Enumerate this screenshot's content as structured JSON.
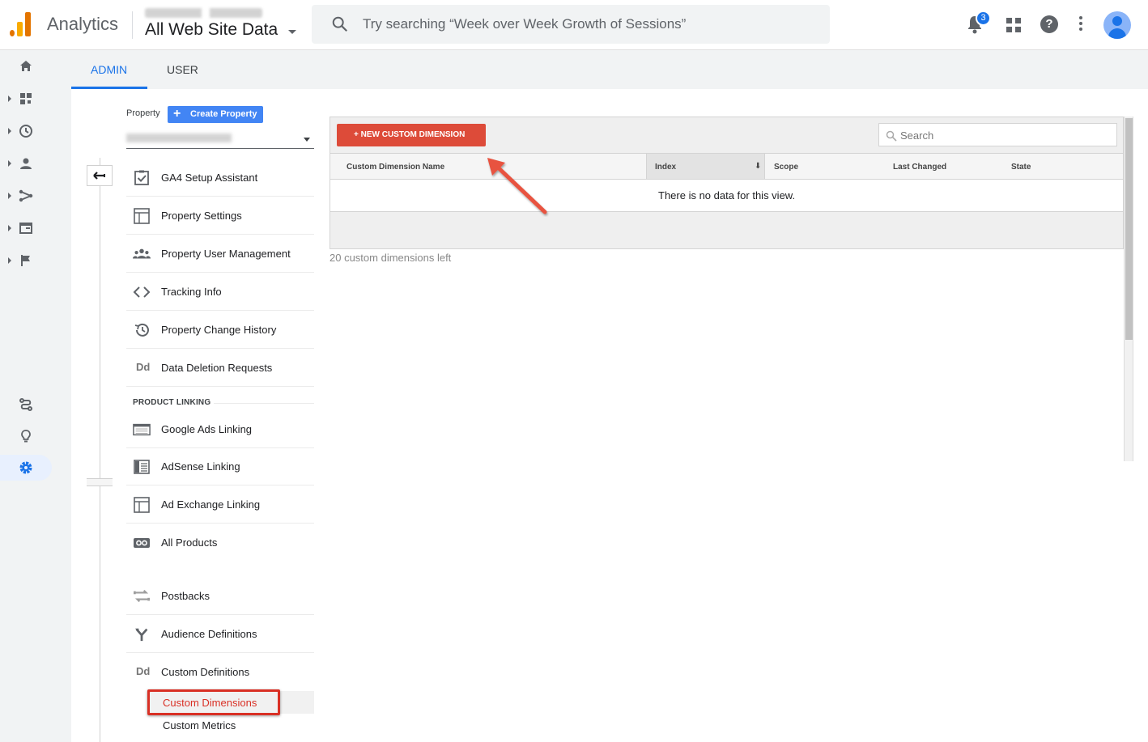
{
  "header": {
    "app_name": "Analytics",
    "view_name": "All Web Site Data",
    "search_placeholder": "Try searching “Week over Week Growth of Sessions”",
    "notification_count": "3",
    "help_label": "?"
  },
  "tabs": {
    "admin": "ADMIN",
    "user": "USER"
  },
  "property": {
    "label": "Property",
    "create_button": "Create Property",
    "create_plus": "+"
  },
  "menu": {
    "items": [
      {
        "label": "GA4 Setup Assistant",
        "icon": "checkbox-icon"
      },
      {
        "label": "Property Settings",
        "icon": "settings-panel-icon"
      },
      {
        "label": "Property User Management",
        "icon": "people-icon"
      },
      {
        "label": "Tracking Info",
        "icon": "code-icon"
      },
      {
        "label": "Property Change History",
        "icon": "history-icon"
      },
      {
        "label": "Data Deletion Requests",
        "icon": "dd-icon",
        "glyph": "Dd"
      }
    ],
    "section_product_linking": "PRODUCT LINKING",
    "linking": [
      {
        "label": "Google Ads Linking",
        "icon": "ads-icon"
      },
      {
        "label": "AdSense Linking",
        "icon": "adsense-icon"
      },
      {
        "label": "Ad Exchange Linking",
        "icon": "ad-exchange-icon"
      },
      {
        "label": "All Products",
        "icon": "link-icon"
      }
    ],
    "other": [
      {
        "label": "Postbacks",
        "icon": "postbacks-icon"
      },
      {
        "label": "Audience Definitions",
        "icon": "audience-icon"
      },
      {
        "label": "Custom Definitions",
        "icon": "dd-icon",
        "glyph": "Dd"
      }
    ],
    "sub_items": [
      {
        "label": "Custom Dimensions",
        "active": true
      },
      {
        "label": "Custom Metrics",
        "active": false
      }
    ]
  },
  "panel": {
    "new_button": "+ NEW CUSTOM DIMENSION",
    "search_placeholder": "Search",
    "columns": [
      "Custom Dimension Name",
      "Index",
      "Scope",
      "Last Changed",
      "State"
    ],
    "sort_indicator": "⬇",
    "empty_message": "There is no data for this view.",
    "remaining": "20 custom dimensions left"
  },
  "colors": {
    "brand_orange": "#e37400",
    "accent_blue": "#1a73e8",
    "button_red": "#dd4b39",
    "highlight_red": "#d93025",
    "arrow_red": "#e8533f"
  }
}
